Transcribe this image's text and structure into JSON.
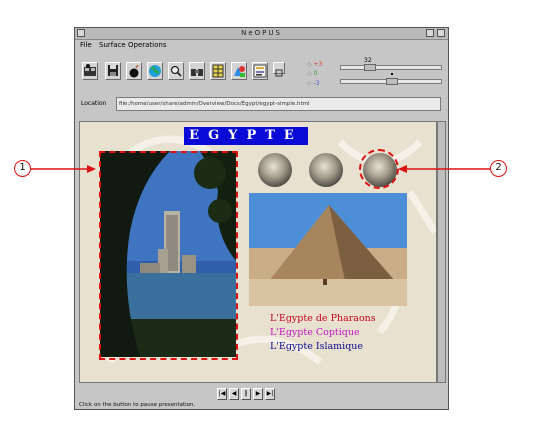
{
  "window": {
    "title": "NeOPUS",
    "menu": [
      "File",
      "Surface",
      "Operations"
    ],
    "location_label": "Location",
    "location_value": "file:/home/user/share/admin/Overview/Docs/Egypt/egypt-simple.html",
    "slider_value": "32",
    "radios": [
      {
        "label": "+3",
        "color": "#d43c3c"
      },
      {
        "label": "0",
        "color": "#2f9a3a"
      },
      {
        "label": "-3",
        "color": "#4a5bd0"
      }
    ],
    "status": "Click on the button to pause presentation."
  },
  "page": {
    "title": "EGYPTE",
    "links": [
      {
        "text": "L'Egypte de Pharaons",
        "color": "#c4001c"
      },
      {
        "text": "L'Egypte Coptique",
        "color": "#c012c0"
      },
      {
        "text": "L'Egypte Islamique",
        "color": "#0a0a8c"
      }
    ]
  },
  "callouts": [
    "1",
    "2"
  ],
  "colors": {
    "highlight": "#dd1111",
    "title_bg": "#0a0ad6"
  },
  "toolbar_icons": [
    "film-icon",
    "save-icon",
    "bomb-icon",
    "globe-icon",
    "search-icon",
    "binoculars-icon",
    "grid-icon",
    "shapes-icon",
    "list-icon",
    "small-box-icon"
  ]
}
